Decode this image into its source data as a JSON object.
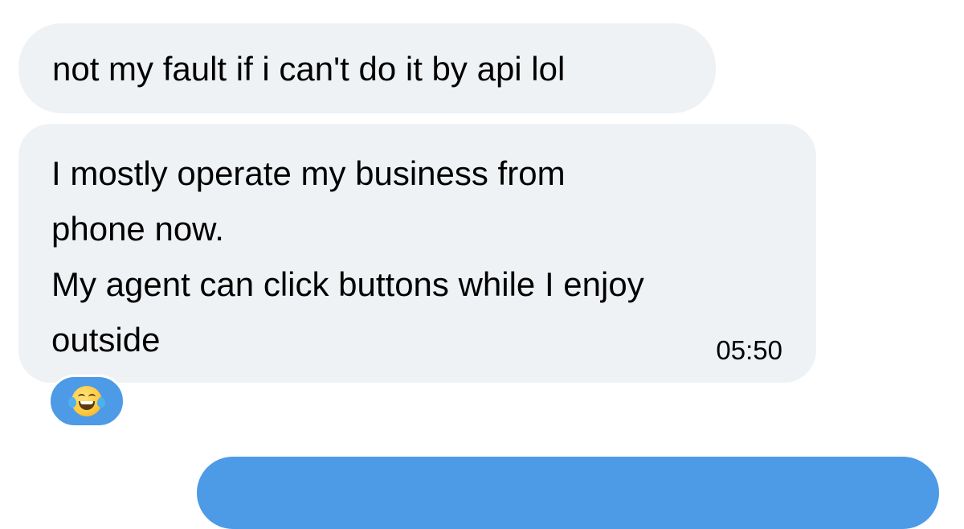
{
  "messages": [
    {
      "direction": "incoming",
      "text": "not my fault if i can't do it by api lol"
    },
    {
      "direction": "incoming",
      "lines": [
        "I mostly operate my business from",
        "phone now.",
        "My agent can click buttons while I enjoy",
        "outside"
      ],
      "time": "05:50",
      "reaction": "face-with-tears-of-joy-icon"
    },
    {
      "direction": "outgoing",
      "text": ""
    }
  ],
  "colors": {
    "incoming_bubble": "#eff2f4",
    "outgoing_bubble": "#4d9ae7",
    "text": "#000000",
    "background": "#ffffff"
  }
}
